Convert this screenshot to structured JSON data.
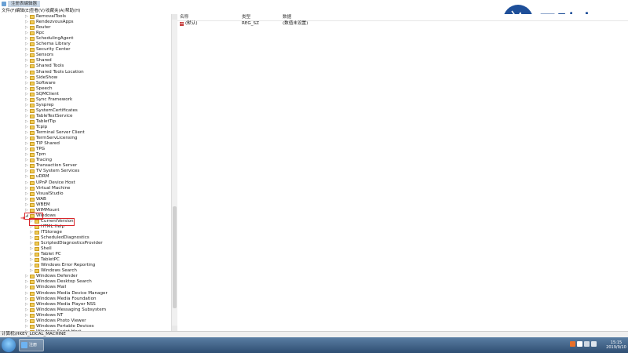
{
  "window": {
    "title": "注册表编辑器"
  },
  "menu": [
    "文件(F)",
    "编辑(E)",
    "查看(V)",
    "收藏夹(A)",
    "帮助(H)"
  ],
  "watermark": {
    "brand": "云骑士"
  },
  "tree": {
    "items_level1_top": [
      "RemovalTools",
      "RendezvousApps",
      "Router",
      "Rpc",
      "SchedulingAgent",
      "Schema Library",
      "Security Center",
      "Sensors",
      "Shared",
      "Shared Tools",
      "Shared Tools Location",
      "SideShow",
      "Software",
      "Speech",
      "SQMClient",
      "Sync Framework",
      "Sysprep",
      "SystemCertificates",
      "TableTextService",
      "TabletTip",
      "Tcpip",
      "Terminal Server Client",
      "TermServLicensing",
      "TIP Shared",
      "TPG",
      "Tpm",
      "Tracing",
      "Transaction Server",
      "TV System Services",
      "uDRM",
      "UPnP Device Host",
      "Virtual Machine",
      "VisualStudio",
      "WAB",
      "WBEM",
      "WIMMount",
      "Windows"
    ],
    "selected": "CurrentVersion",
    "items_level2": [
      "HTML Help",
      "ITStorage",
      "ScheduledDiagnostics",
      "ScriptedDiagnosticsProvider",
      "Shell",
      "Tablet PC",
      "TabletPC",
      "Windows Error Reporting",
      "Windows Search"
    ],
    "items_level1_bottom": [
      "Windows Defender",
      "Windows Desktop Search",
      "Windows Mail",
      "Windows Media Device Manager",
      "Windows Media Foundation",
      "Windows Media Player NSS",
      "Windows Messaging Subsystem",
      "Windows NT",
      "Windows Photo Viewer",
      "Windows Portable Devices",
      "Windows Script Host"
    ]
  },
  "values": {
    "columns": {
      "name": "名称",
      "type": "类型",
      "data": "数据"
    },
    "rows": [
      {
        "name": "(默认)",
        "type": "REG_SZ",
        "data": "(数值未设置)"
      }
    ]
  },
  "status": {
    "path": "计算机\\HKEY_LOCAL_MACHINE"
  },
  "taskbar": {
    "task_label": "注册",
    "time": "15:15",
    "date": "2019/9/10"
  },
  "colors": {
    "highlight": "#d9262b",
    "brand": "#1e4f99",
    "folder": "#f0cc56"
  }
}
